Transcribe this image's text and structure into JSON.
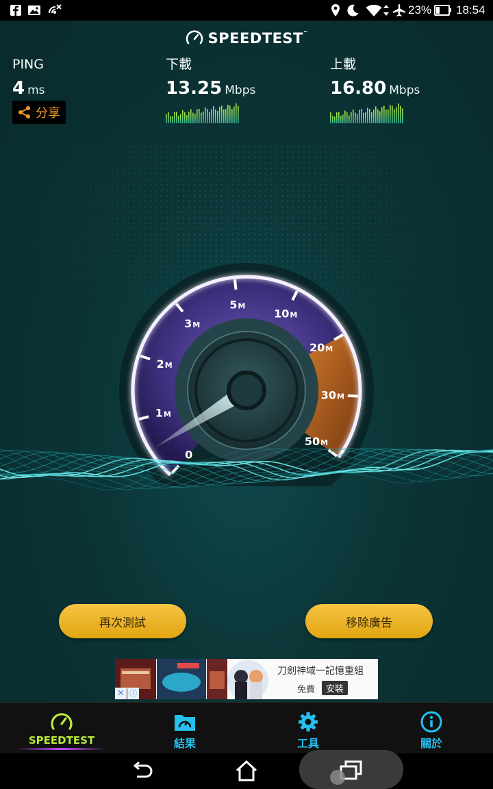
{
  "status_bar": {
    "battery_percent": "23%",
    "time": "18:54",
    "icons": [
      "facebook-icon",
      "photo-icon",
      "satellite-off-icon",
      "location-icon",
      "do-not-disturb-icon",
      "wifi-icon",
      "data-arrows-icon",
      "airplane-icon",
      "battery-icon"
    ]
  },
  "header": {
    "app_name": "SPEEDTEST",
    "trademark": "™"
  },
  "results": {
    "ping": {
      "label": "PING",
      "value": "4",
      "unit": "ms"
    },
    "download": {
      "label": "下載",
      "value": "13.25",
      "unit": "Mbps"
    },
    "upload": {
      "label": "上載",
      "value": "16.80",
      "unit": "Mbps"
    }
  },
  "share_label": "分享",
  "gauge": {
    "ticks": [
      {
        "main": "0",
        "suffix": ""
      },
      {
        "main": "1",
        "suffix": "M"
      },
      {
        "main": "2",
        "suffix": "M"
      },
      {
        "main": "3",
        "suffix": "M"
      },
      {
        "main": "5",
        "suffix": "M"
      },
      {
        "main": "10",
        "suffix": "M"
      },
      {
        "main": "20",
        "suffix": "M"
      },
      {
        "main": "30",
        "suffix": "M"
      },
      {
        "main": "50",
        "suffix": "M"
      }
    ]
  },
  "buttons": {
    "retest": "再次測試",
    "remove_ads": "移除廣告"
  },
  "ad": {
    "title": "刀劍神域一記憶重組",
    "free": "免費",
    "install": "安裝",
    "close": "✕",
    "info": "ⓘ"
  },
  "tabs": [
    {
      "label": "SPEEDTEST",
      "icon": "speedometer-icon",
      "active": true
    },
    {
      "label": "結果",
      "icon": "results-folder-icon",
      "active": false
    },
    {
      "label": "工具",
      "icon": "gear-icon",
      "active": false
    },
    {
      "label": "關於",
      "icon": "info-icon",
      "active": false
    }
  ],
  "nav": [
    "back-icon",
    "home-icon",
    "recents-icon"
  ],
  "colors": {
    "accent_orange": "#f39a2b",
    "tab_blue": "#25c0f0",
    "tab_active": "#b7ea3c",
    "button_gold": "#f0b82c"
  }
}
